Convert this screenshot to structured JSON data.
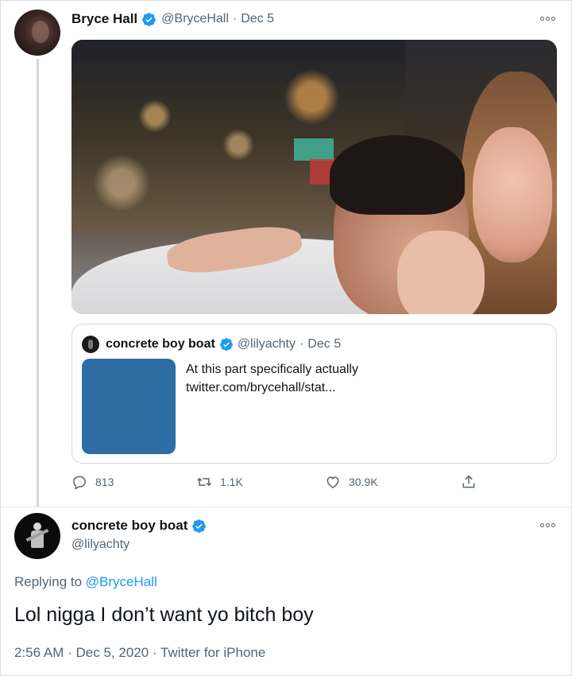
{
  "colors": {
    "accent": "#1d9bf0",
    "text": "#0f1419",
    "muted": "#536471",
    "border": "#cfd9de"
  },
  "original_tweet": {
    "author_name": "Bryce Hall",
    "author_handle": "@BryceHall",
    "separator": "·",
    "date": "Dec 5",
    "avatar_icon": "profile-photo",
    "quoted_tweet": {
      "author_name": "concrete boy boat",
      "author_handle": "@lilyachty",
      "separator": "·",
      "date": "Dec 5",
      "text_line1": "At this part specifically actually",
      "text_line2": "twitter.com/brycehall/stat..."
    },
    "actions": {
      "replies": "813",
      "retweets": "1.1K",
      "likes": "30.9K"
    }
  },
  "reply_tweet": {
    "author_name": "concrete boy boat",
    "author_handle": "@lilyachty",
    "replying_label": "Replying to",
    "replying_to": "@BryceHall",
    "text": "Lol nigga I don’t want yo bitch boy",
    "time": "2:56 AM",
    "date": "Dec 5, 2020",
    "source": "Twitter for iPhone",
    "separator": "·"
  }
}
